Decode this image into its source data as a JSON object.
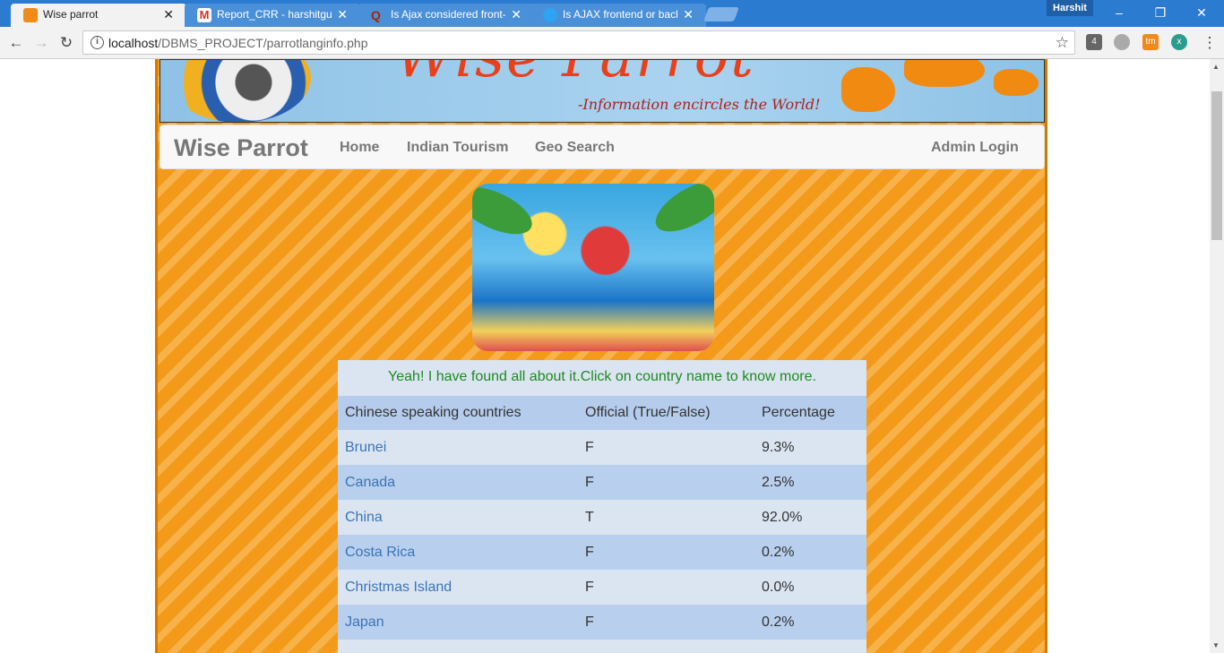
{
  "browser": {
    "tabs": [
      {
        "title": "Wise parrot",
        "active": true,
        "favicon_color": "#f08a1a"
      },
      {
        "title": "Report_CRR - harshitguj",
        "active": false,
        "favicon_color": "#d93025"
      },
      {
        "title": "Is Ajax considered front-",
        "active": false,
        "favicon_color": "#a82400"
      },
      {
        "title": "Is AJAX frontend or back",
        "active": false,
        "favicon_color": "#2ea3f2"
      }
    ],
    "close_glyph": "✕",
    "profile_name": "Harshit",
    "url_host": "localhost",
    "url_path": "/DBMS_PROJECT/parrotlanginfo.php",
    "extension_badges": [
      "4",
      "x"
    ]
  },
  "site": {
    "banner_title": "Wise Parrot",
    "banner_tagline": "-Information encircles the World!",
    "brand": "Wise Parrot",
    "nav_items": [
      "Home",
      "Indian Tourism",
      "Geo Search"
    ],
    "admin_login": "Admin Login"
  },
  "results": {
    "message": "Yeah! I have found all about it.Click on country name to know more.",
    "headers": [
      "Chinese speaking countries",
      "Official (True/False)",
      "Percentage"
    ],
    "rows": [
      {
        "country": "Brunei",
        "official": "F",
        "percentage": "9.3%"
      },
      {
        "country": "Canada",
        "official": "F",
        "percentage": "2.5%"
      },
      {
        "country": "China",
        "official": "T",
        "percentage": "92.0%"
      },
      {
        "country": "Costa Rica",
        "official": "F",
        "percentage": "0.2%"
      },
      {
        "country": "Christmas Island",
        "official": "F",
        "percentage": "0.0%"
      },
      {
        "country": "Japan",
        "official": "F",
        "percentage": "0.2%"
      },
      {
        "country": "",
        "official": "",
        "percentage": ""
      }
    ]
  },
  "colors": {
    "page_stripe": "#f39a1a",
    "link": "#3a74b6",
    "message_text": "#1e8a1e"
  }
}
